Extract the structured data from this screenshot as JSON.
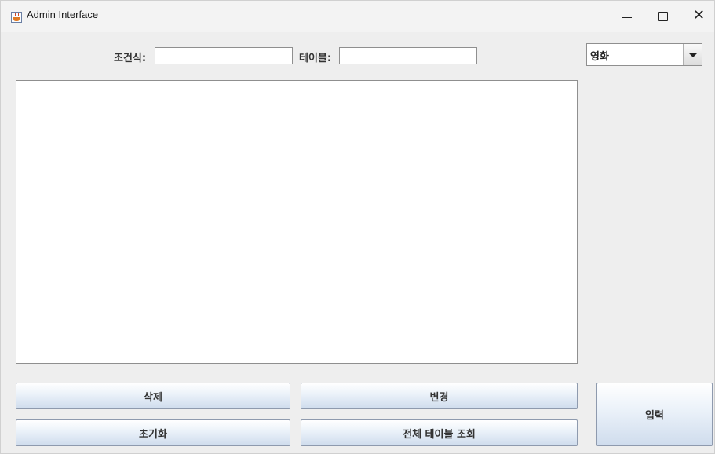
{
  "window": {
    "title": "Admin Interface",
    "controls": {
      "minimize": "minimize",
      "maximize": "maximize",
      "close": "close"
    }
  },
  "form": {
    "condition_label": "조건식:",
    "condition_value": "",
    "table_label": "테이블:",
    "table_value": ""
  },
  "table_select": {
    "selected": "영화"
  },
  "output": {
    "text": ""
  },
  "buttons": {
    "delete": "삭제",
    "update": "변경",
    "reset": "초기화",
    "view_all": "전체 테이블 조회",
    "insert": "입력"
  }
}
